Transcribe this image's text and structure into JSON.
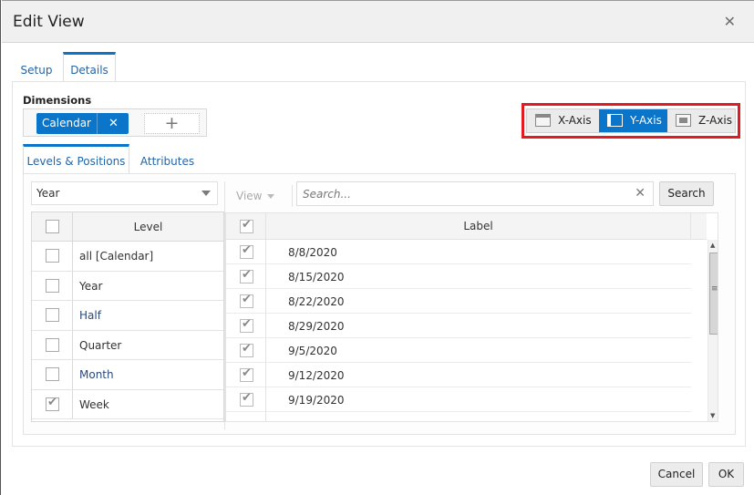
{
  "dialog": {
    "title": "Edit View",
    "close_icon": "close-icon"
  },
  "tabs": [
    {
      "label": "Setup",
      "active": false
    },
    {
      "label": "Details",
      "active": true
    }
  ],
  "dimensions": {
    "label": "Dimensions",
    "chips": [
      {
        "label": "Calendar",
        "remove_icon": "close-icon"
      }
    ],
    "add_icon": "plus-icon"
  },
  "axis_selector": {
    "options": [
      {
        "label": "X-Axis",
        "icon": "x-axis-icon",
        "selected": false
      },
      {
        "label": "Y-Axis",
        "icon": "y-axis-icon",
        "selected": true
      },
      {
        "label": "Z-Axis",
        "icon": "z-axis-icon",
        "selected": false
      }
    ],
    "highlight_color": "#e21a22",
    "accent_color": "#0b75c9"
  },
  "subtabs": [
    {
      "label": "Levels & Positions",
      "active": true
    },
    {
      "label": "Attributes",
      "active": false
    }
  ],
  "levels": {
    "select_value": "Year",
    "header": "Level",
    "header_checked": false,
    "rows": [
      {
        "label": "all [Calendar]",
        "checked": false
      },
      {
        "label": "Year",
        "checked": false
      },
      {
        "label": "Half",
        "checked": false
      },
      {
        "label": "Quarter",
        "checked": false
      },
      {
        "label": "Month",
        "checked": false
      },
      {
        "label": "Week",
        "checked": true
      }
    ]
  },
  "positions": {
    "view_label": "View",
    "search_placeholder": "Search...",
    "search_value": "",
    "search_button": "Search",
    "header": "Label",
    "header_checked": true,
    "rows": [
      {
        "label": "8/8/2020",
        "checked": true
      },
      {
        "label": "8/15/2020",
        "checked": true
      },
      {
        "label": "8/22/2020",
        "checked": true
      },
      {
        "label": "8/29/2020",
        "checked": true
      },
      {
        "label": "9/5/2020",
        "checked": true
      },
      {
        "label": "9/12/2020",
        "checked": true
      },
      {
        "label": "9/19/2020",
        "checked": true
      }
    ]
  },
  "footer": {
    "cancel_label": "Cancel",
    "ok_label": "OK"
  }
}
